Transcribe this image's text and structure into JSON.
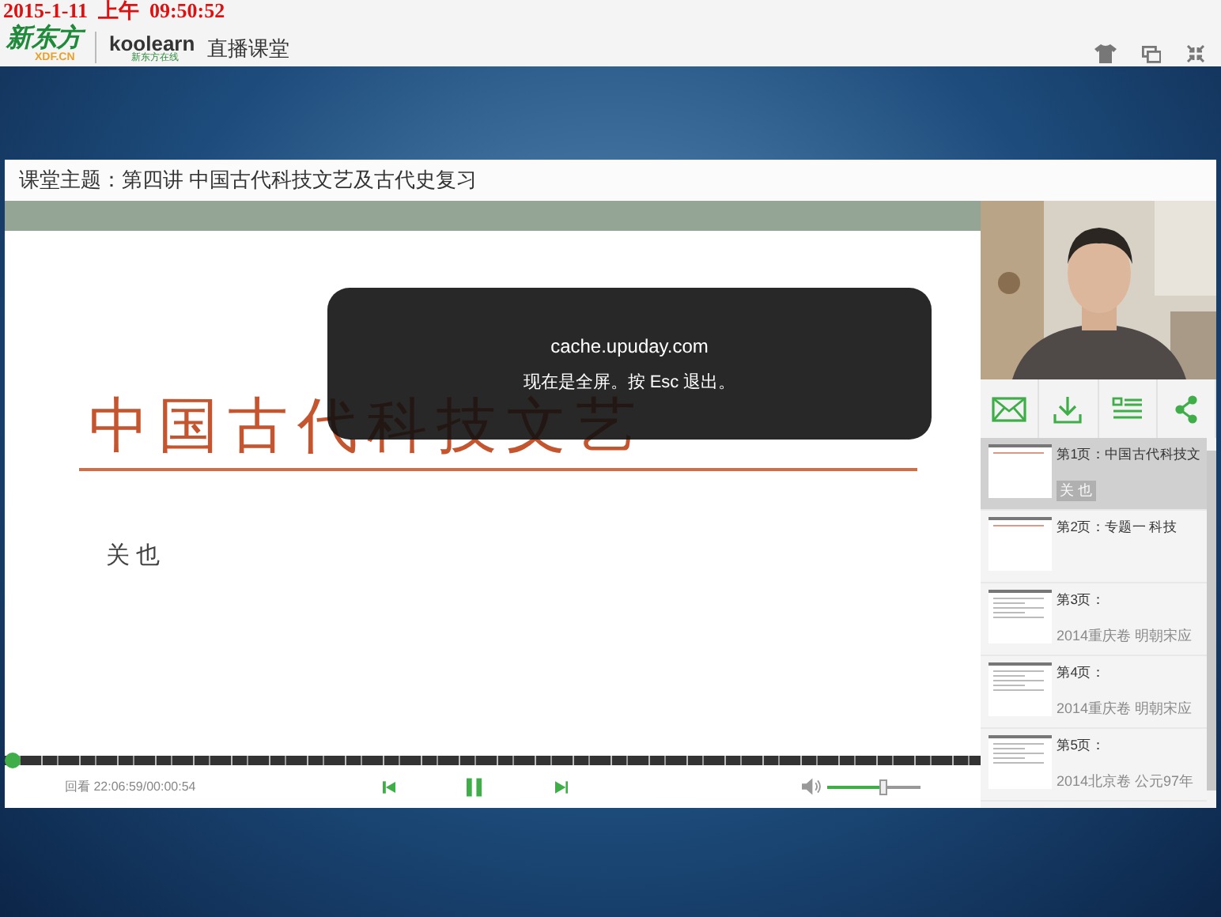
{
  "stamp": "2015-1-11  上午  09:50:52",
  "header": {
    "logo_main": "新东方",
    "logo_sub": "XDF.CN",
    "brand": "koolearn",
    "brand_sub": "新东方在线",
    "title": "直播课堂"
  },
  "topic": "课堂主题：第四讲 中国古代科技文艺及古代史复习",
  "slide": {
    "title": "中国古代科技文艺",
    "author": "关 也"
  },
  "notice": {
    "host": "cache.upuday.com",
    "message": "现在是全屏。按 Esc 退出。"
  },
  "pages": [
    {
      "label": "第1页：中国古代科技文",
      "sub": "关 也",
      "selected": true
    },
    {
      "label": "第2页：专题一 科技",
      "selected": false
    },
    {
      "label": "第3页：",
      "sub": "2014重庆卷 明朝宋应",
      "selected": false
    },
    {
      "label": "第4页：",
      "sub": "2014重庆卷 明朝宋应",
      "selected": false
    },
    {
      "label": "第5页：",
      "sub": "2014北京卷 公元97年",
      "selected": false
    }
  ],
  "player": {
    "time": "回看 22:06:59/00:00:54",
    "progress": {
      "level": 0.0
    },
    "volume": {
      "level": 0.6
    },
    "playing": true
  }
}
